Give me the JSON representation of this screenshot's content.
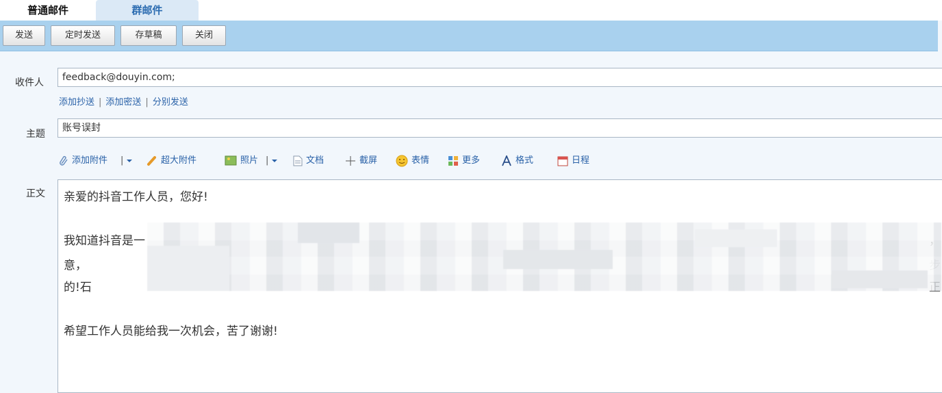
{
  "tabs": {
    "normal": "普通邮件",
    "other": "群邮件"
  },
  "toolbar": {
    "send": "发送",
    "scheduled_send": "定时发送",
    "save_draft": "存草稿",
    "close": "关闭"
  },
  "form": {
    "recipient_label": "收件人",
    "recipient_value": "feedback@douyin.com;",
    "add_cc": "添加抄送",
    "add_bcc": "添加密送",
    "separate_send": "分别发送",
    "subject_label": "主题",
    "subject_value": "账号误封",
    "body_label": "正文"
  },
  "compose_tools": {
    "attachment": "添加附件",
    "large_attachment": "超大附件",
    "image": "照片",
    "document": "文档",
    "screenshot": "截屏",
    "emoji": "表情",
    "more": "更多",
    "format": "格式",
    "calendar": "日程"
  },
  "body": {
    "greeting": "亲爱的抖音工作人员，您好!",
    "line1_start": "我知道抖音是一",
    "line1_end": "，",
    "line2_start": "意，",
    "line2_end": "步",
    "line3_start": "的!石",
    "line3_end": "正",
    "closing": "希望工作人员能给我一次机会，苦了谢谢!"
  }
}
